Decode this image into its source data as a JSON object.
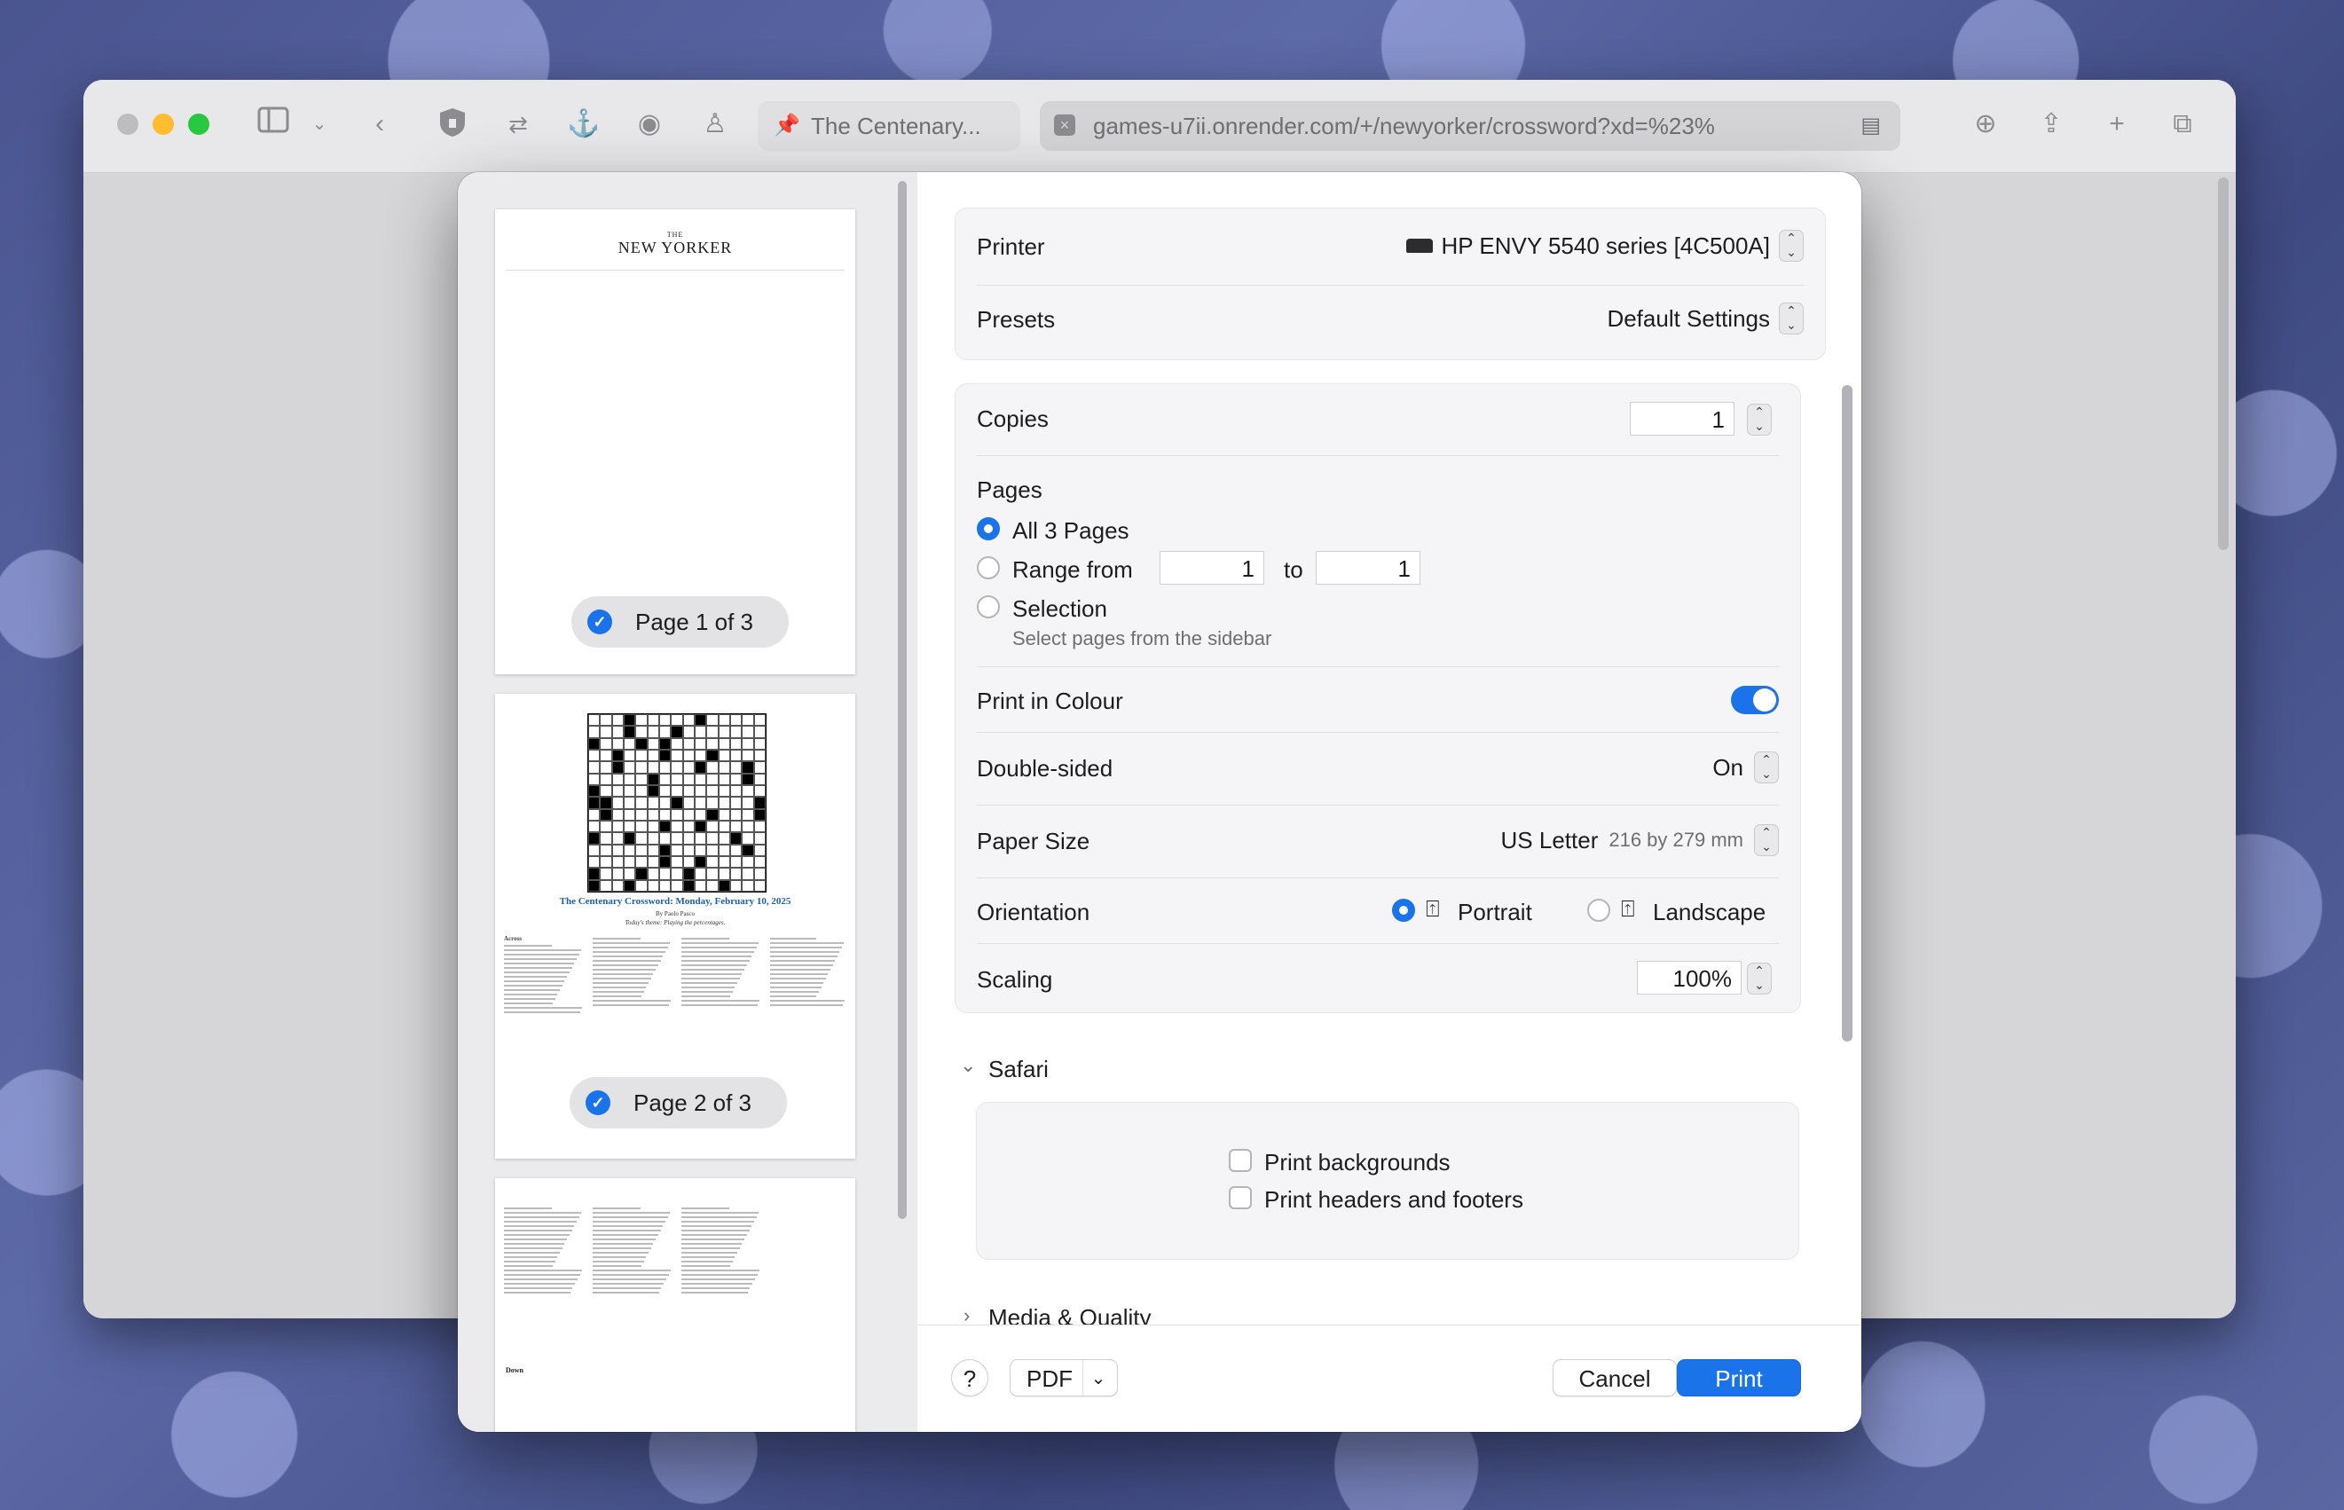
{
  "browser": {
    "tabs": [
      {
        "label": "The Centenary..."
      },
      {
        "label": "games-u7ii.onrender.com/+/newyorker/crossword?xd=%23%"
      }
    ],
    "toolbar_icons": [
      "sidebar-icon",
      "chevron-down-icon",
      "back-icon",
      "shield-icon",
      "shuffle-icon",
      "anchor-icon",
      "circle-icon",
      "figure-icon",
      "download-icon",
      "share-icon",
      "plus-icon",
      "tabs-overview-icon"
    ]
  },
  "preview": {
    "pages": [
      {
        "badge": "Page 1 of 3",
        "selected": true,
        "masthead_top": "THE",
        "masthead": "NEW YORKER"
      },
      {
        "badge": "Page 2 of 3",
        "selected": true,
        "title": "The Centenary Crossword: Monday, February 10, 2025",
        "byline": "By Paolo Pasco",
        "theme": "Today's theme: Playing the percentages.",
        "across_label": "Across"
      },
      {
        "selected": false,
        "down_label": "Down"
      }
    ]
  },
  "print": {
    "printer": {
      "label": "Printer",
      "value": "HP ENVY 5540 series [4C500A]"
    },
    "presets": {
      "label": "Presets",
      "value": "Default Settings"
    },
    "copies": {
      "label": "Copies",
      "value": "1"
    },
    "pages": {
      "label": "Pages",
      "all": "All 3 Pages",
      "range": "Range from",
      "range_from": "1",
      "range_to_label": "to",
      "range_to": "1",
      "selection": "Selection",
      "selection_hint": "Select pages from the sidebar"
    },
    "print_in_colour": {
      "label": "Print in Colour",
      "on": true
    },
    "double_sided": {
      "label": "Double-sided",
      "value": "On"
    },
    "paper_size": {
      "label": "Paper Size",
      "value": "US Letter",
      "detail": "216 by 279 mm"
    },
    "orientation": {
      "label": "Orientation",
      "portrait": "Portrait",
      "landscape": "Landscape",
      "selected": "Portrait"
    },
    "scaling": {
      "label": "Scaling",
      "value": "100%"
    },
    "safari": {
      "label": "Safari",
      "print_backgrounds": "Print backgrounds",
      "print_headers_footers": "Print headers and footers"
    },
    "media_quality": {
      "label": "Media & Quality"
    }
  },
  "footer": {
    "help": "?",
    "pdf": "PDF",
    "cancel": "Cancel",
    "print": "Print"
  },
  "colors": {
    "accent": "#1a73e8",
    "close": "#ff5f57",
    "minimize": "#febc2e",
    "zoom": "#28c840"
  }
}
